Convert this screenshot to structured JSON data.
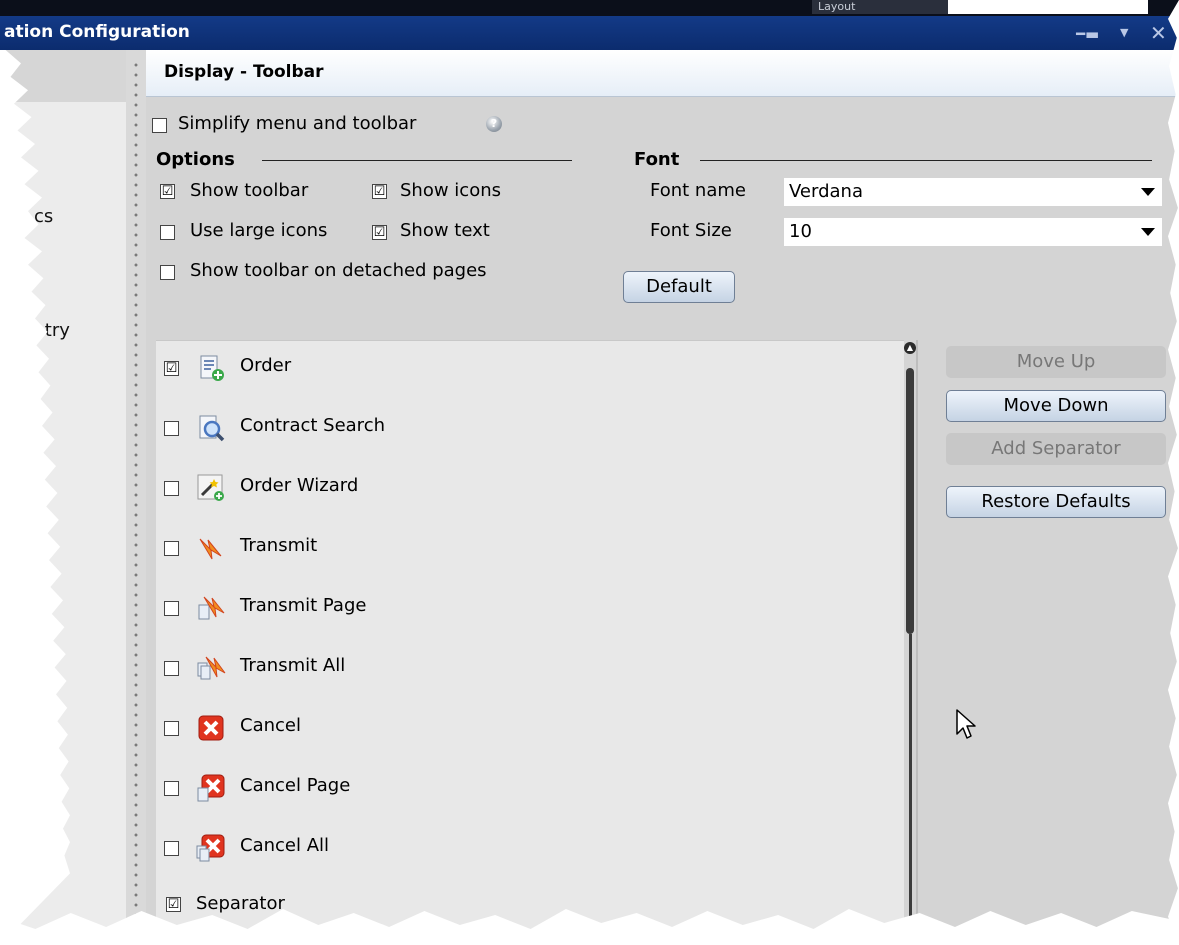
{
  "window": {
    "title": "ation Configuration",
    "layout_chip": "Layout"
  },
  "left_nav": {
    "items": [
      "cs",
      "Entry"
    ]
  },
  "section_title": "Display - Toolbar",
  "simplify": {
    "label": "Simplify menu and toolbar",
    "checked": false
  },
  "options": {
    "heading": "Options",
    "show_toolbar": {
      "label": "Show toolbar",
      "checked": true
    },
    "show_icons": {
      "label": "Show icons",
      "checked": true
    },
    "use_large_icons": {
      "label": "Use large icons",
      "checked": false
    },
    "show_text": {
      "label": "Show text",
      "checked": true
    },
    "show_toolbar_detached": {
      "label": "Show toolbar on detached pages",
      "checked": false
    }
  },
  "font": {
    "heading": "Font",
    "name_label": "Font name",
    "name_value": "Verdana",
    "size_label": "Font Size",
    "size_value": "10",
    "default_button": "Default"
  },
  "toolbar_items": [
    {
      "label": "Order",
      "checked": true,
      "icon": "order-icon"
    },
    {
      "label": "Contract Search",
      "checked": false,
      "icon": "contract-search-icon"
    },
    {
      "label": "Order Wizard",
      "checked": false,
      "icon": "order-wizard-icon"
    },
    {
      "label": "Transmit",
      "checked": false,
      "icon": "transmit-icon"
    },
    {
      "label": "Transmit Page",
      "checked": false,
      "icon": "transmit-page-icon"
    },
    {
      "label": "Transmit All",
      "checked": false,
      "icon": "transmit-all-icon"
    },
    {
      "label": "Cancel",
      "checked": false,
      "icon": "cancel-icon"
    },
    {
      "label": "Cancel Page",
      "checked": false,
      "icon": "cancel-page-icon"
    },
    {
      "label": "Cancel All",
      "checked": false,
      "icon": "cancel-all-icon"
    },
    {
      "label": "Separator",
      "checked": true,
      "icon": ""
    }
  ],
  "side_buttons": {
    "move_up": "Move Up",
    "move_down": "Move Down",
    "add_separator": "Add Separator",
    "restore_defaults": "Restore Defaults"
  },
  "check_mark": "☑",
  "colors": {
    "titlebar": "#133a87",
    "button_accent": "#c5d3e4"
  }
}
